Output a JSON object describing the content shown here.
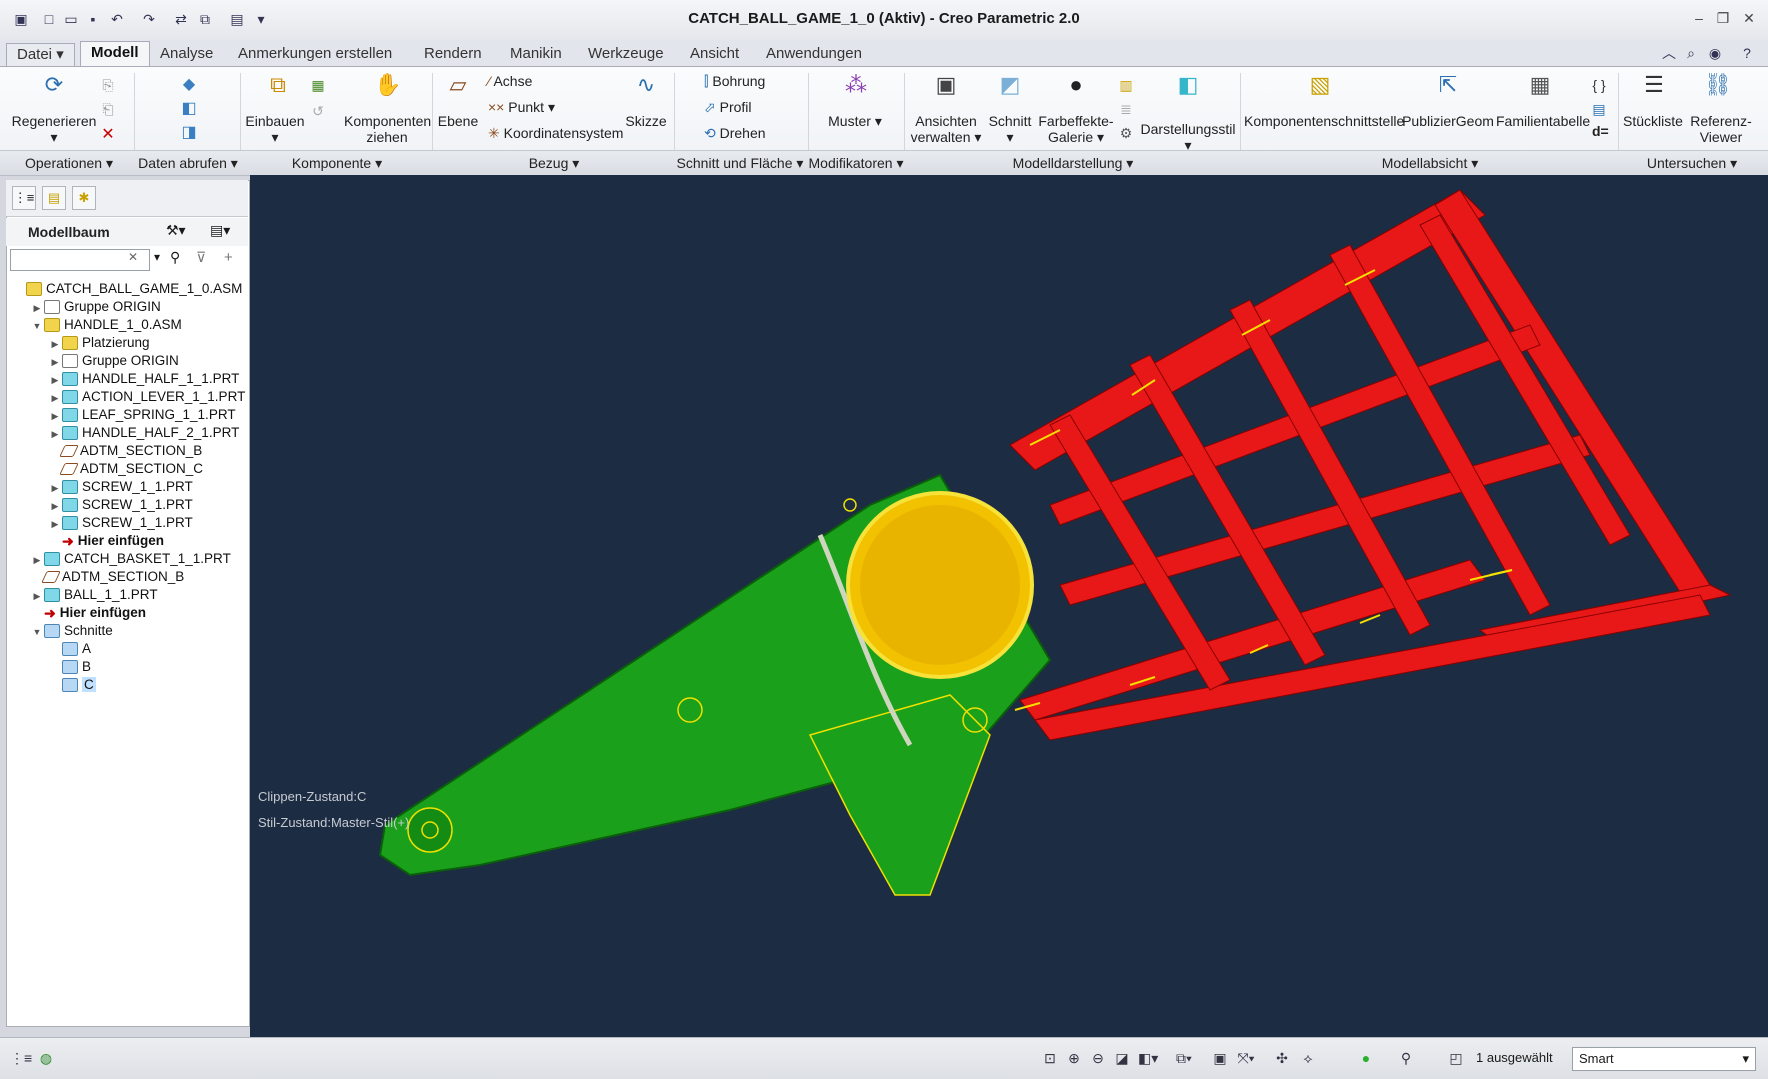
{
  "window": {
    "title": "CATCH_BALL_GAME_1_0 (Aktiv) - Creo Parametric 2.0"
  },
  "menu": {
    "datei": "Datei",
    "tabs": [
      "Modell",
      "Analyse",
      "Anmerkungen erstellen",
      "Rendern",
      "Manikin",
      "Werkzeuge",
      "Ansicht",
      "Anwendungen"
    ]
  },
  "ribbon": {
    "regenerieren": "Regenerieren",
    "einbauen": "Einbauen",
    "komponenten_ziehen_1": "Komponenten",
    "komponenten_ziehen_2": "ziehen",
    "ebene": "Ebene",
    "achse": "Achse",
    "punkt": "Punkt",
    "koordinatensystem": "Koordinatensystem",
    "skizze": "Skizze",
    "bohrung": "Bohrung",
    "profil": "Profil",
    "drehen": "Drehen",
    "muster": "Muster",
    "ansichten_1": "Ansichten",
    "ansichten_2": "verwalten",
    "schnitt": "Schnitt",
    "farbeffekte_1": "Farbeffekte-",
    "farbeffekte_2": "Galerie",
    "darstellungsstil": "Darstellungsstil",
    "komponentenschnittstelle": "Komponentenschnittstelle",
    "publiziergeom": "PublizierGeom",
    "familientabelle": "Familientabelle",
    "stueckliste": "Stückliste",
    "referenz_1": "Referenz-",
    "referenz_2": "Viewer",
    "d_equals": "d="
  },
  "groups": [
    "Operationen",
    "Daten abrufen",
    "Komponente",
    "Bezug",
    "Schnitt und Fläche",
    "Modifikatoren",
    "Modelldarstellung",
    "Modellabsicht",
    "Untersuchen"
  ],
  "left_panel": {
    "title": "Modellbaum",
    "search_value": ""
  },
  "tree": [
    {
      "label": "CATCH_BALL_GAME_1_0.ASM",
      "icon": "asm",
      "indent": 0,
      "exp": ""
    },
    {
      "label": "Gruppe ORIGIN",
      "icon": "grp",
      "indent": 1,
      "exp": "▶"
    },
    {
      "label": "HANDLE_1_0.ASM",
      "icon": "asm",
      "indent": 1,
      "exp": "▼"
    },
    {
      "label": "Platzierung",
      "icon": "asm",
      "indent": 2,
      "exp": "▶"
    },
    {
      "label": "Gruppe ORIGIN",
      "icon": "grp",
      "indent": 2,
      "exp": "▶"
    },
    {
      "label": "HANDLE_HALF_1_1.PRT",
      "icon": "prt",
      "indent": 2,
      "exp": "▶"
    },
    {
      "label": "ACTION_LEVER_1_1.PRT",
      "icon": "prt",
      "indent": 2,
      "exp": "▶"
    },
    {
      "label": "LEAF_SPRING_1_1.PRT",
      "icon": "prt",
      "indent": 2,
      "exp": "▶"
    },
    {
      "label": "HANDLE_HALF_2_1.PRT",
      "icon": "prt",
      "indent": 2,
      "exp": "▶"
    },
    {
      "label": "ADTM_SECTION_B",
      "icon": "dtm",
      "indent": 2,
      "exp": ""
    },
    {
      "label": "ADTM_SECTION_C",
      "icon": "dtm",
      "indent": 2,
      "exp": ""
    },
    {
      "label": "SCREW_1_1.PRT",
      "icon": "prt",
      "indent": 2,
      "exp": "▶"
    },
    {
      "label": "SCREW_1_1.PRT",
      "icon": "prt",
      "indent": 2,
      "exp": "▶"
    },
    {
      "label": "SCREW_1_1.PRT",
      "icon": "prt",
      "indent": 2,
      "exp": "▶"
    },
    {
      "label": "Hier einfügen",
      "icon": "ins",
      "indent": 2,
      "exp": ""
    },
    {
      "label": "CATCH_BASKET_1_1.PRT",
      "icon": "prt",
      "indent": 1,
      "exp": "▶"
    },
    {
      "label": "ADTM_SECTION_B",
      "icon": "dtm",
      "indent": 1,
      "exp": ""
    },
    {
      "label": "BALL_1_1.PRT",
      "icon": "prt",
      "indent": 1,
      "exp": "▶"
    },
    {
      "label": "Hier einfügen",
      "icon": "ins",
      "indent": 1,
      "exp": ""
    },
    {
      "label": "Schnitte",
      "icon": "sec",
      "indent": 1,
      "exp": "▼"
    },
    {
      "label": "A",
      "icon": "sec",
      "indent": 2,
      "exp": ""
    },
    {
      "label": "B",
      "icon": "sec",
      "indent": 2,
      "exp": ""
    },
    {
      "label": "C",
      "icon": "sec",
      "indent": 2,
      "exp": ""
    }
  ],
  "viewport": {
    "clip_state": "Clippen-Zustand:C",
    "style_state": "Stil-Zustand:Master-Stil(+)"
  },
  "status": {
    "selected": "1 ausgewählt",
    "filter": "Smart"
  },
  "colors": {
    "viewport_bg": "#1c2c42",
    "handle": "#1a9e1a",
    "basket": "#ee1a1a",
    "ball": "#f2c200"
  }
}
